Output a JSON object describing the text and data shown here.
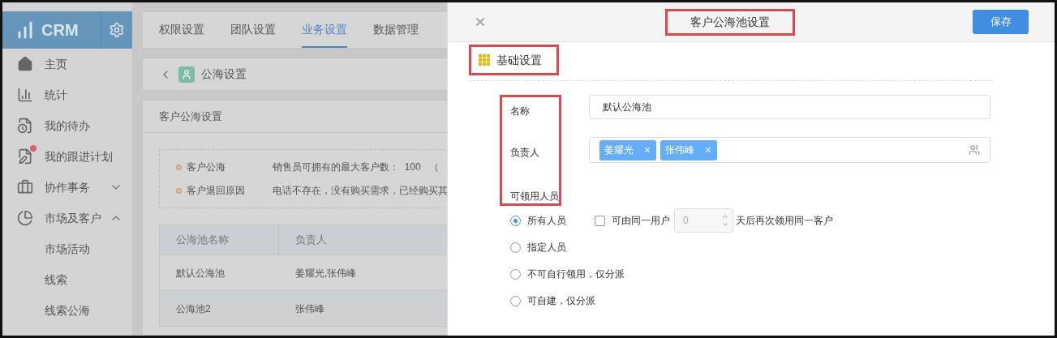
{
  "sidebar": {
    "logo": "CRM",
    "items": [
      {
        "label": "主页"
      },
      {
        "label": "统计"
      },
      {
        "label": "我的待办"
      },
      {
        "label": "我的跟进计划",
        "has_notification": true
      },
      {
        "label": "协作事务",
        "expanded": false
      },
      {
        "label": "市场及客户",
        "expanded": true,
        "children": [
          {
            "label": "市场活动"
          },
          {
            "label": "线索"
          },
          {
            "label": "线索公海"
          }
        ]
      }
    ]
  },
  "tabs": [
    {
      "label": "权限设置",
      "selected": false
    },
    {
      "label": "团队设置",
      "selected": false
    },
    {
      "label": "业务设置",
      "selected": true
    },
    {
      "label": "数据管理",
      "selected": false
    }
  ],
  "breadcrumb": "公海设置",
  "card": {
    "title": "客户公海设置",
    "info": [
      {
        "label": "客户公海",
        "text": "销售员可拥有的最大客户数：  100   （"
      },
      {
        "label": "客户退回原因",
        "text": "电话不存在，没有购买需求，已经购买其"
      }
    ],
    "table": {
      "columns": [
        "公海池名称",
        "负责人"
      ],
      "rows": [
        [
          "默认公海池",
          "姜耀光,张伟峰"
        ],
        [
          "公海池2",
          "张伟峰"
        ]
      ]
    }
  },
  "panel": {
    "title": "客户公海池设置",
    "save": "保存",
    "section": "基础设置",
    "name_label": "名称",
    "name_value": "默认公海池",
    "owner_label": "负责人",
    "owners": [
      "姜耀光",
      "张伟峰"
    ],
    "claim_label": "可领用人员",
    "options": [
      {
        "label": "所有人员",
        "selected": true,
        "extra": {
          "checkbox_label": "可由同一用户",
          "checked": false,
          "value": "0",
          "suffix": "天后再次领用同一客户"
        }
      },
      {
        "label": "指定人员",
        "selected": false
      },
      {
        "label": "不可自行领用，仅分派",
        "selected": false
      },
      {
        "label": "可自建，仅分派",
        "selected": false
      }
    ]
  }
}
